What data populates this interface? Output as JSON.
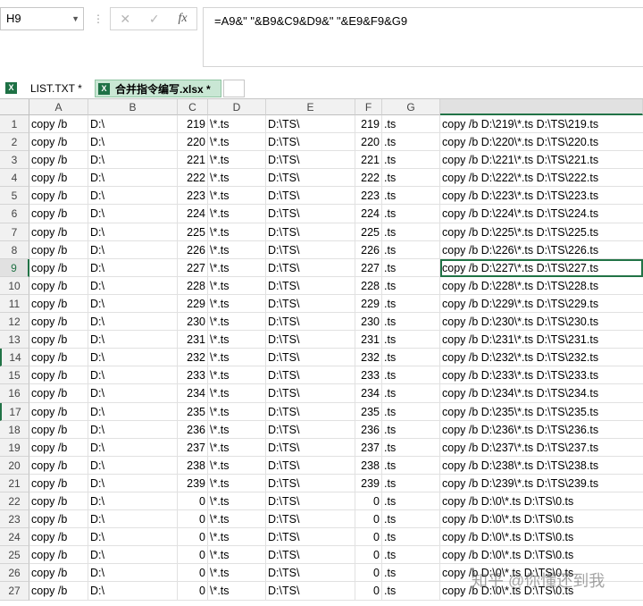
{
  "name_box": "H9",
  "formula_buttons": {
    "cancel": "✕",
    "enter": "✓",
    "fx": "fx"
  },
  "formula": "=A9&\" \"&B9&C9&D9&\" \"&E9&F9&G9",
  "tabs": [
    {
      "label": "LIST.TXT *",
      "active": false
    },
    {
      "label": "合并指令编写.xlsx *",
      "active": true
    }
  ],
  "columns": [
    "A",
    "B",
    "C",
    "D",
    "E",
    "F",
    "G",
    ""
  ],
  "selected_row": 9,
  "selected_col": 7,
  "rows": [
    {
      "n": "1",
      "a": "copy /b",
      "b": "D:\\",
      "c": "219",
      "d": "\\*.ts",
      "e": "D:\\TS\\",
      "f": "219",
      "g": ".ts",
      "h": "copy /b D:\\219\\*.ts D:\\TS\\219.ts"
    },
    {
      "n": "2",
      "a": "copy /b",
      "b": "D:\\",
      "c": "220",
      "d": "\\*.ts",
      "e": "D:\\TS\\",
      "f": "220",
      "g": ".ts",
      "h": "copy /b D:\\220\\*.ts D:\\TS\\220.ts"
    },
    {
      "n": "3",
      "a": "copy /b",
      "b": "D:\\",
      "c": "221",
      "d": "\\*.ts",
      "e": "D:\\TS\\",
      "f": "221",
      "g": ".ts",
      "h": "copy /b D:\\221\\*.ts D:\\TS\\221.ts"
    },
    {
      "n": "4",
      "a": "copy /b",
      "b": "D:\\",
      "c": "222",
      "d": "\\*.ts",
      "e": "D:\\TS\\",
      "f": "222",
      "g": ".ts",
      "h": "copy /b D:\\222\\*.ts D:\\TS\\222.ts"
    },
    {
      "n": "5",
      "a": "copy /b",
      "b": "D:\\",
      "c": "223",
      "d": "\\*.ts",
      "e": "D:\\TS\\",
      "f": "223",
      "g": ".ts",
      "h": "copy /b D:\\223\\*.ts D:\\TS\\223.ts"
    },
    {
      "n": "6",
      "a": "copy /b",
      "b": "D:\\",
      "c": "224",
      "d": "\\*.ts",
      "e": "D:\\TS\\",
      "f": "224",
      "g": ".ts",
      "h": "copy /b D:\\224\\*.ts D:\\TS\\224.ts"
    },
    {
      "n": "7",
      "a": "copy /b",
      "b": "D:\\",
      "c": "225",
      "d": "\\*.ts",
      "e": "D:\\TS\\",
      "f": "225",
      "g": ".ts",
      "h": "copy /b D:\\225\\*.ts D:\\TS\\225.ts"
    },
    {
      "n": "8",
      "a": "copy /b",
      "b": "D:\\",
      "c": "226",
      "d": "\\*.ts",
      "e": "D:\\TS\\",
      "f": "226",
      "g": ".ts",
      "h": "copy /b D:\\226\\*.ts D:\\TS\\226.ts"
    },
    {
      "n": "9",
      "a": "copy /b",
      "b": "D:\\",
      "c": "227",
      "d": "\\*.ts",
      "e": "D:\\TS\\",
      "f": "227",
      "g": ".ts",
      "h": "copy /b D:\\227\\*.ts D:\\TS\\227.ts"
    },
    {
      "n": "10",
      "a": "copy /b",
      "b": "D:\\",
      "c": "228",
      "d": "\\*.ts",
      "e": "D:\\TS\\",
      "f": "228",
      "g": ".ts",
      "h": "copy /b D:\\228\\*.ts D:\\TS\\228.ts"
    },
    {
      "n": "11",
      "a": "copy /b",
      "b": "D:\\",
      "c": "229",
      "d": "\\*.ts",
      "e": "D:\\TS\\",
      "f": "229",
      "g": ".ts",
      "h": "copy /b D:\\229\\*.ts D:\\TS\\229.ts"
    },
    {
      "n": "12",
      "a": "copy /b",
      "b": "D:\\",
      "c": "230",
      "d": "\\*.ts",
      "e": "D:\\TS\\",
      "f": "230",
      "g": ".ts",
      "h": "copy /b D:\\230\\*.ts D:\\TS\\230.ts"
    },
    {
      "n": "13",
      "a": "copy /b",
      "b": "D:\\",
      "c": "231",
      "d": "\\*.ts",
      "e": "D:\\TS\\",
      "f": "231",
      "g": ".ts",
      "h": "copy /b D:\\231\\*.ts D:\\TS\\231.ts"
    },
    {
      "n": "14",
      "a": "copy /b",
      "b": "D:\\",
      "c": "232",
      "d": "\\*.ts",
      "e": "D:\\TS\\",
      "f": "232",
      "g": ".ts",
      "h": "copy /b D:\\232\\*.ts D:\\TS\\232.ts"
    },
    {
      "n": "15",
      "a": "copy /b",
      "b": "D:\\",
      "c": "233",
      "d": "\\*.ts",
      "e": "D:\\TS\\",
      "f": "233",
      "g": ".ts",
      "h": "copy /b D:\\233\\*.ts D:\\TS\\233.ts"
    },
    {
      "n": "16",
      "a": "copy /b",
      "b": "D:\\",
      "c": "234",
      "d": "\\*.ts",
      "e": "D:\\TS\\",
      "f": "234",
      "g": ".ts",
      "h": "copy /b D:\\234\\*.ts D:\\TS\\234.ts"
    },
    {
      "n": "17",
      "a": "copy /b",
      "b": "D:\\",
      "c": "235",
      "d": "\\*.ts",
      "e": "D:\\TS\\",
      "f": "235",
      "g": ".ts",
      "h": "copy /b D:\\235\\*.ts D:\\TS\\235.ts"
    },
    {
      "n": "18",
      "a": "copy /b",
      "b": "D:\\",
      "c": "236",
      "d": "\\*.ts",
      "e": "D:\\TS\\",
      "f": "236",
      "g": ".ts",
      "h": "copy /b D:\\236\\*.ts D:\\TS\\236.ts"
    },
    {
      "n": "19",
      "a": "copy /b",
      "b": "D:\\",
      "c": "237",
      "d": "\\*.ts",
      "e": "D:\\TS\\",
      "f": "237",
      "g": ".ts",
      "h": "copy /b D:\\237\\*.ts D:\\TS\\237.ts"
    },
    {
      "n": "20",
      "a": "copy /b",
      "b": "D:\\",
      "c": "238",
      "d": "\\*.ts",
      "e": "D:\\TS\\",
      "f": "238",
      "g": ".ts",
      "h": "copy /b D:\\238\\*.ts D:\\TS\\238.ts"
    },
    {
      "n": "21",
      "a": "copy /b",
      "b": "D:\\",
      "c": "239",
      "d": "\\*.ts",
      "e": "D:\\TS\\",
      "f": "239",
      "g": ".ts",
      "h": "copy /b D:\\239\\*.ts D:\\TS\\239.ts"
    },
    {
      "n": "22",
      "a": "copy /b",
      "b": "D:\\",
      "c": "0",
      "d": "\\*.ts",
      "e": "D:\\TS\\",
      "f": "0",
      "g": ".ts",
      "h": "copy /b D:\\0\\*.ts D:\\TS\\0.ts"
    },
    {
      "n": "23",
      "a": "copy /b",
      "b": "D:\\",
      "c": "0",
      "d": "\\*.ts",
      "e": "D:\\TS\\",
      "f": "0",
      "g": ".ts",
      "h": "copy /b D:\\0\\*.ts D:\\TS\\0.ts"
    },
    {
      "n": "24",
      "a": "copy /b",
      "b": "D:\\",
      "c": "0",
      "d": "\\*.ts",
      "e": "D:\\TS\\",
      "f": "0",
      "g": ".ts",
      "h": "copy /b D:\\0\\*.ts D:\\TS\\0.ts"
    },
    {
      "n": "25",
      "a": "copy /b",
      "b": "D:\\",
      "c": "0",
      "d": "\\*.ts",
      "e": "D:\\TS\\",
      "f": "0",
      "g": ".ts",
      "h": "copy /b D:\\0\\*.ts D:\\TS\\0.ts"
    },
    {
      "n": "26",
      "a": "copy /b",
      "b": "D:\\",
      "c": "0",
      "d": "\\*.ts",
      "e": "D:\\TS\\",
      "f": "0",
      "g": ".ts",
      "h": "copy /b D:\\0\\*.ts D:\\TS\\0.ts"
    },
    {
      "n": "27",
      "a": "copy /b",
      "b": "D:\\",
      "c": "0",
      "d": "\\*.ts",
      "e": "D:\\TS\\",
      "f": "0",
      "g": ".ts",
      "h": "copy /b D:\\0\\*.ts D:\\TS\\0.ts"
    }
  ],
  "watermark": "知乎 @你懂还到我",
  "colors": {
    "accent": "#217346",
    "tab_active_bg": "#c9e7d4",
    "header_bg": "#f1f1f1"
  }
}
